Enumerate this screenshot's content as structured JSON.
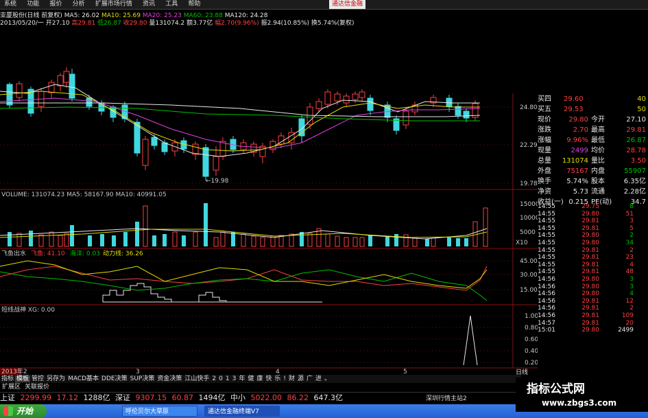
{
  "menu": [
    "系统",
    "功能",
    "报价",
    "分析",
    "扩展市场行情",
    "资讯",
    "工具",
    "帮助"
  ],
  "brand_tag": "通达信金融",
  "info_line1": {
    "stock": "亚厦股份(日线 前复权)",
    "ma5": "MA5: 26.02",
    "ma10": "MA10: 25.69",
    "ma20": "MA20: 25.23",
    "ma60": "MA60: 23.88",
    "ma120": "MA120: 24.28"
  },
  "info_line2": {
    "date": "2013/05/20/一",
    "open": "开27.10",
    "high": "高29.81",
    "low": "低26.87",
    "close": "收29.80",
    "volume": "量131074.2",
    "amount": "额3.77亿",
    "change": "幅2.70(9.96%)",
    "amplitude": "振2.94(10.85%)",
    "turnover": "换5.74%(复权)"
  },
  "price_axis": [
    "24.80",
    "22.29",
    "19.78"
  ],
  "low_marker": "←19.98",
  "volume_header": "VOLUME: 131074.23  MA5: 58167.90  MA10: 40991.05",
  "volume_axis": [
    "15000",
    "10000",
    "5000",
    "X10"
  ],
  "ind1_header": {
    "name": "飞鱼出水",
    "a": "飞鱼: 41.10",
    "b": "海洋: 0.03",
    "c": "动力线: 36.26"
  },
  "ind1_axis": [
    "45.00",
    "30.00",
    "15.00"
  ],
  "ind2_header": "短线战神 XG: 0.00",
  "ind2_axis": [
    "1.00",
    "0.80",
    "0.60",
    "0.40",
    "0.20"
  ],
  "date_axis": {
    "left": "2013年2",
    "mid1": "3",
    "mid2": "4",
    "mid3": "5"
  },
  "quotes": [
    {
      "k1": "买四",
      "v1": "29.60",
      "v2": "40",
      "c1": "r",
      "c2": "y"
    },
    {
      "k1": "买五",
      "v1": "29.53",
      "v2": "50",
      "c1": "r",
      "c2": "y"
    },
    {
      "k1": "现价",
      "v1": "29.80",
      "k2": "今开",
      "v2": "27.10",
      "c1": "r",
      "c2": "w"
    },
    {
      "k1": "涨跌",
      "v1": "2.70",
      "k2": "最高",
      "v2": "29.81",
      "c1": "r",
      "c2": "r"
    },
    {
      "k1": "涨幅",
      "v1": "9.96%",
      "k2": "最低",
      "v2": "26.87",
      "c1": "r",
      "c2": "g"
    },
    {
      "k1": "现量",
      "v1": "2499",
      "k2": "均价",
      "v2": "28.78",
      "c1": "m",
      "c2": "r"
    },
    {
      "k1": "总量",
      "v1": "131074",
      "k2": "量比",
      "v2": "3.50",
      "c1": "y",
      "c2": "r"
    },
    {
      "k1": "外盘",
      "v1": "75167",
      "k2": "内盘",
      "v2": "55907",
      "c1": "r",
      "c2": "g"
    },
    {
      "k1": "换手",
      "v1": "5.74%",
      "k2": "股本",
      "v2": "6.35亿",
      "c1": "w",
      "c2": "w"
    },
    {
      "k1": "净资",
      "v1": "5.73",
      "k2": "流通",
      "v2": "2.28亿",
      "c1": "w",
      "c2": "w"
    },
    {
      "k1": "收益(一)",
      "v1": "0.215",
      "k2": "PE(动)",
      "v2": "34.7",
      "c1": "w",
      "c2": "w"
    }
  ],
  "ticks": [
    {
      "t": "14:55",
      "p": "29.75",
      "v": "8",
      "vc": "g"
    },
    {
      "t": "14:55",
      "p": "29.80",
      "v": "51",
      "vc": "r"
    },
    {
      "t": "14:55",
      "p": "29.81",
      "v": "3",
      "vc": "r"
    },
    {
      "t": "14:55",
      "p": "29.81",
      "v": "5",
      "vc": "r"
    },
    {
      "t": "14:55",
      "p": "29.80",
      "v": "2",
      "vc": "g"
    },
    {
      "t": "14:55",
      "p": "29.80",
      "v": "34",
      "vc": "g"
    },
    {
      "t": "14:55",
      "p": "29.81",
      "v": "2",
      "vc": "r"
    },
    {
      "t": "14:55",
      "p": "29.81",
      "v": "23",
      "vc": "r"
    },
    {
      "t": "14:55",
      "p": "29.81",
      "v": "4",
      "vc": "r"
    },
    {
      "t": "14:55",
      "p": "29.81",
      "v": "48",
      "vc": "r"
    },
    {
      "t": "14:56",
      "p": "29.80",
      "v": "3",
      "vc": "g"
    },
    {
      "t": "14:56",
      "p": "29.80",
      "v": "3",
      "vc": "g"
    },
    {
      "t": "14:56",
      "p": "29.80",
      "v": "4",
      "vc": "g"
    },
    {
      "t": "14:56",
      "p": "29.81",
      "v": "12",
      "vc": "r"
    },
    {
      "t": "14:56",
      "p": "29.81",
      "v": "2",
      "vc": "r"
    },
    {
      "t": "14:56",
      "p": "29.81",
      "v": "109",
      "vc": "r"
    },
    {
      "t": "14:57",
      "p": "29.81",
      "v": "20",
      "vc": "r"
    },
    {
      "t": "15:01",
      "p": "29.80",
      "v": "2499",
      "vc": "w"
    }
  ],
  "daily_label": "日线",
  "bottom_tabs": [
    "指标",
    "模板",
    "管控",
    "另存为",
    "MACD基本",
    "DDE决策",
    "SUP决策",
    "资金决策",
    "江山快手",
    "2",
    "0",
    "1",
    "3",
    "年",
    "健",
    "康",
    "快",
    "乐",
    "!",
    "财",
    "源",
    "广",
    "进",
    "。"
  ],
  "ext_bar": [
    "扩展区",
    "关联报价"
  ],
  "index_bar": [
    {
      "text": "上证",
      "c": "w"
    },
    {
      "text": "2299.99",
      "c": "r"
    },
    {
      "text": "17.12",
      "c": "r"
    },
    {
      "text": "1288亿",
      "c": "w"
    },
    {
      "text": "深证",
      "c": "w"
    },
    {
      "text": "9307.15",
      "c": "r"
    },
    {
      "text": "60.87",
      "c": "r"
    },
    {
      "text": "1494亿",
      "c": "w"
    },
    {
      "text": "中小",
      "c": "w"
    },
    {
      "text": "5022.00",
      "c": "r"
    },
    {
      "text": "86.22",
      "c": "r"
    },
    {
      "text": "647.3亿",
      "c": "w"
    }
  ],
  "server_label": "深圳行情主站2",
  "taskbar": {
    "start": "开始",
    "item1": "呼伦贝尔大草原",
    "item2": "通达信金融终端V7"
  },
  "watermark": {
    "line1": "指标公式网",
    "line2": "www.zbgs3.com"
  },
  "colors": {
    "up": "#ff4040",
    "down": "#40d8e0",
    "ma_white": "#e8e8e8",
    "ma_yellow": "#e0e000",
    "ma_magenta": "#e040e0",
    "ma_green": "#00c000"
  }
}
